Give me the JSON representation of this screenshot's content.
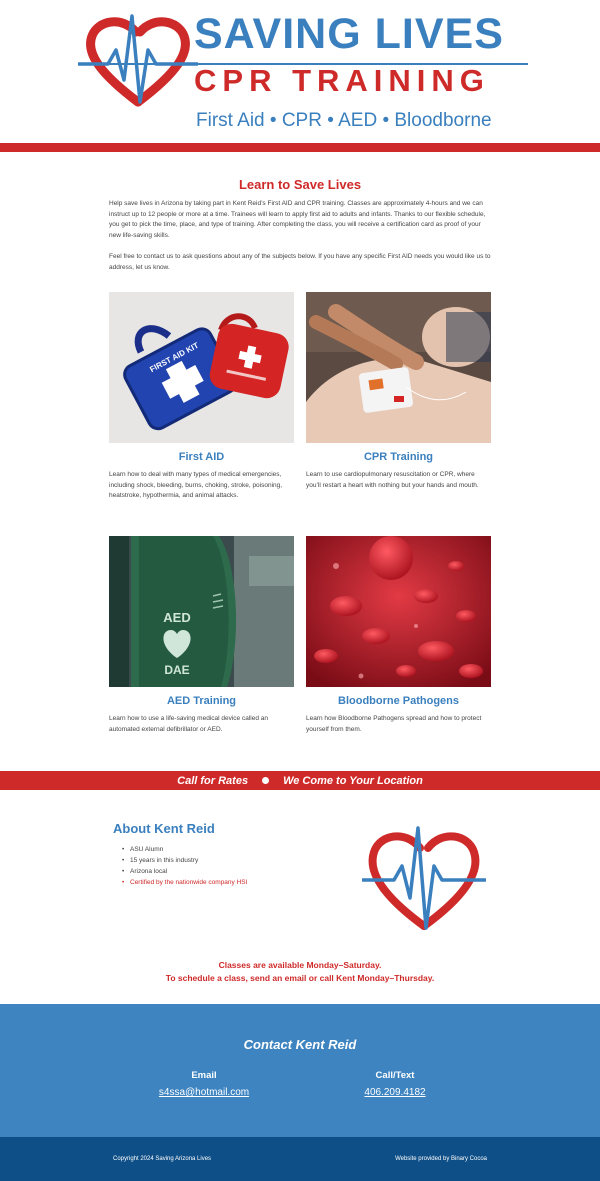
{
  "header": {
    "brand_title": "SAVING LIVES",
    "brand_subtitle": "CPR TRAINING",
    "services": "First Aid  • CPR • AED • Bloodborne"
  },
  "intro": {
    "title": "Learn to Save Lives",
    "paragraph_1": "Help save lives in Arizona by taking part in Kent Reid’s First AID and CPR training. Classes are approximately 4-hours and we can instruct up to 12 people or more at a time. Trainees will learn to apply first aid to adults and infants. Thanks to our flexible schedule, you get to pick the time, place, and type of training. After completing the class, you will receive a certification card as proof of your new life-saving skills.",
    "paragraph_2": "Feel free to contact us to ask questions about any of the subjects below. If you have any specific First AID needs you would like us to address, let us know."
  },
  "cards": [
    {
      "title": "First AID",
      "description": "Learn how to deal with many types of medical emergencies, including shock, bleeding, burns, choking, stroke, poisoning, heatstroke, hypothermia, and animal attacks.",
      "image_text": "FIRST AID KIT"
    },
    {
      "title": "CPR Training",
      "description": "Learn to use cardiopulmonary resuscitation or CPR, where you’ll restart a heart with nothing but your hands and mouth."
    },
    {
      "title": "AED Training",
      "description": "Learn how to use a life-saving medical device called an automated external defibrillator or AED.",
      "image_text_top": "AED",
      "image_text_bottom": "DAE"
    },
    {
      "title": "Bloodborne Pathogens",
      "description": "Learn how Bloodborne Pathogens spread and how to protect yourself from them."
    }
  ],
  "banner": {
    "left": "Call for Rates",
    "right": "We Come to Your Location"
  },
  "about": {
    "title": "About Kent Reid",
    "items": [
      "ASU Alumn",
      "15 years in this industry",
      "Arizona local",
      "Certified by the nationwide company HSI"
    ]
  },
  "schedule": {
    "line_1": "Classes are available Monday–Saturday.",
    "line_2": "To schedule a class, send an email or call Kent Monday–Thursday."
  },
  "contact": {
    "title": "Contact Kent Reid",
    "email_label": "Email",
    "email": "s4ssa@hotmail.com",
    "phone_label": "Call/Text",
    "phone": "406.209.4182"
  },
  "footer": {
    "copyright": "Copyright 2024 Saving Arizona Lives",
    "credit": "Website provided by Binary Cocoa"
  },
  "colors": {
    "brand_blue": "#3a7fbe",
    "brand_red": "#cf2a2a",
    "contact_bg": "#3d84c1",
    "footer_bg": "#0e4f87"
  }
}
